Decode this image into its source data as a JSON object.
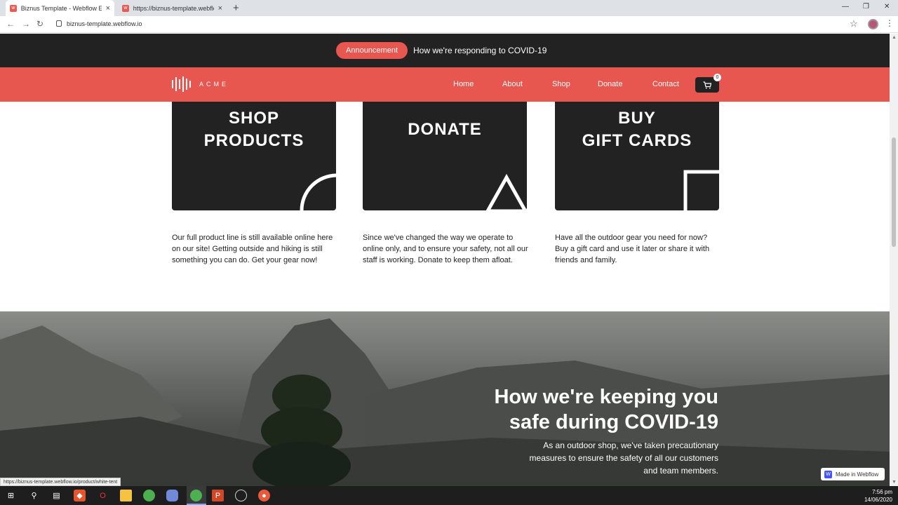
{
  "browser": {
    "tabs": [
      {
        "label": "Biznus Template - Webflow Ecom",
        "active": true
      },
      {
        "label": "https://biznus-template.webflow.io",
        "active": false
      }
    ],
    "url": "biznus-template.webflow.io",
    "status_url": "https://biznus-template.webflow.io/product/white-tent"
  },
  "announcement": {
    "pill_label": "Announcement",
    "text": "How we're responding to COVID-19"
  },
  "navbar": {
    "logo_text": "ACME",
    "links": [
      "Home",
      "About",
      "Shop",
      "Donate",
      "Contact"
    ],
    "cart_count": "0"
  },
  "cards": [
    {
      "title_lines": [
        "SHOP",
        "PRODUCTS"
      ],
      "shape": "circle",
      "description": "Our full product line is still available online here on our site! Getting outside and hiking is still something you can do. Get your gear now!"
    },
    {
      "title_lines": [
        "DONATE"
      ],
      "shape": "triangle",
      "description": "Since we've changed the way we operate to online only, and to ensure your safety, not all our staff is working. Donate to keep them afloat."
    },
    {
      "title_lines": [
        "BUY",
        "GIFT CARDS"
      ],
      "shape": "square",
      "description": "Have all the outdoor gear you need for now? Buy a gift card and use it later or share it with friends and family."
    }
  ],
  "hero": {
    "title_lines": [
      "How we're keeping you",
      "safe during COVID-19"
    ],
    "subtitle": "As an outdoor shop, we've taken precautionary measures to ensure the safety of all our customers and team members."
  },
  "webflow_badge": "Made in Webflow",
  "taskbar": {
    "time": "7:56 pm",
    "date": "14/06/2020"
  },
  "colors": {
    "accent": "#e8574f",
    "dark": "#222222"
  }
}
